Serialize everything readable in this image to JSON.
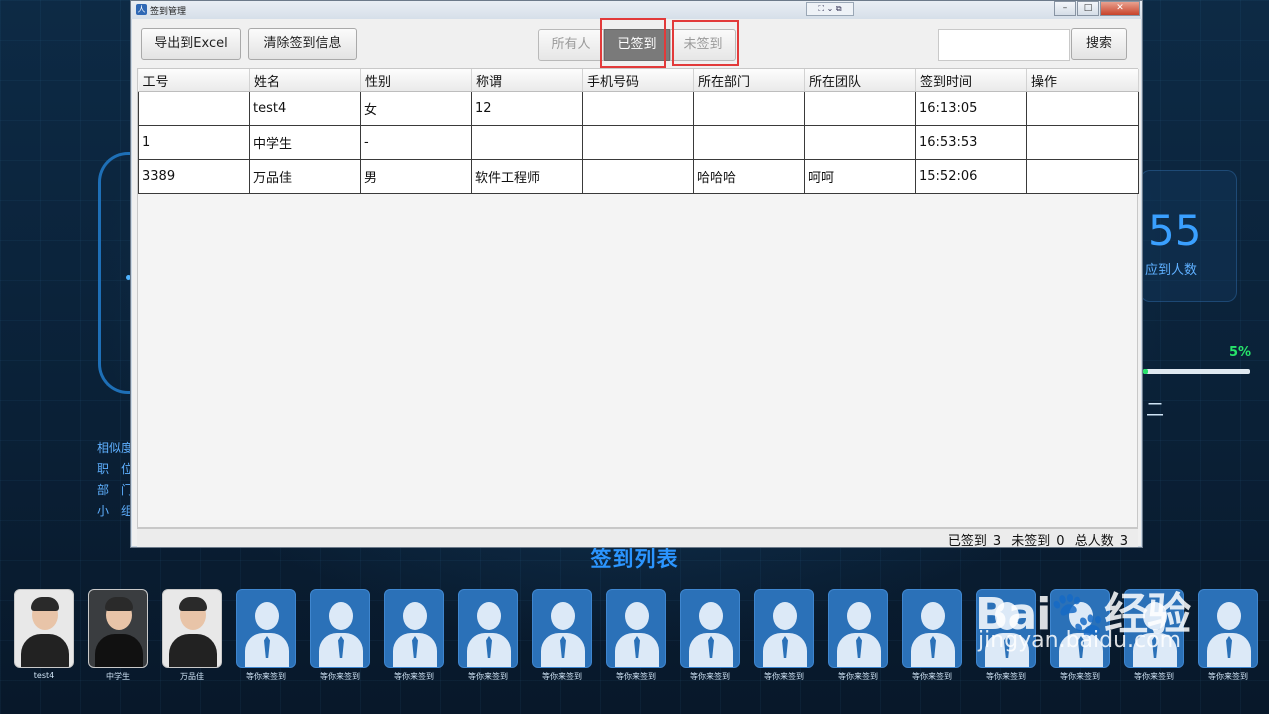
{
  "window": {
    "title": "签到管理",
    "mini_toolbar": "⛶ ⌄ ⧉"
  },
  "toolbar": {
    "export_label": "导出到Excel",
    "clear_label": "清除签到信息",
    "filters": {
      "all": "所有人",
      "signed": "已签到",
      "unsigned": "未签到"
    },
    "active_filter": "已签到",
    "search_value": "",
    "search_label": "搜索"
  },
  "table": {
    "columns": [
      "工号",
      "姓名",
      "性别",
      "称谓",
      "手机号码",
      "所在部门",
      "所在团队",
      "签到时间",
      "操作"
    ],
    "rows": [
      [
        "",
        "test4",
        "女",
        "12",
        "",
        "",
        "",
        "16:13:05",
        ""
      ],
      [
        "1",
        "中学生",
        "-",
        "",
        "",
        "",
        "",
        "16:53:53",
        ""
      ],
      [
        "3389",
        "万品佳",
        "男",
        "软件工程师",
        "",
        "哈哈哈",
        "呵呵",
        "15:52:06",
        ""
      ]
    ]
  },
  "status": {
    "signed_label": "已签到",
    "signed_count": "3",
    "unsigned_label": "未签到",
    "unsigned_count": "0",
    "total_label": "总人数",
    "total_count": "3"
  },
  "background": {
    "left_info": [
      "相似度",
      "职　位",
      "部　门",
      "小　组"
    ],
    "stat_number": "55",
    "stat_label": "应到人数",
    "progress_text": "5%",
    "progress_value": 0.05,
    "right_mark": "二",
    "list_title": "签到列表",
    "avatars": [
      {
        "name": "test4",
        "type": "photo"
      },
      {
        "name": "中学生",
        "type": "photo-dark"
      },
      {
        "name": "万品佳",
        "type": "photo"
      },
      {
        "name": "等你来签到",
        "type": "placeholder"
      },
      {
        "name": "等你来签到",
        "type": "placeholder"
      },
      {
        "name": "等你来签到",
        "type": "placeholder"
      },
      {
        "name": "等你来签到",
        "type": "placeholder"
      },
      {
        "name": "等你来签到",
        "type": "placeholder"
      },
      {
        "name": "等你来签到",
        "type": "placeholder"
      },
      {
        "name": "等你来签到",
        "type": "placeholder"
      },
      {
        "name": "等你来签到",
        "type": "placeholder"
      },
      {
        "name": "等你来签到",
        "type": "placeholder"
      },
      {
        "name": "等你来签到",
        "type": "placeholder"
      },
      {
        "name": "等你来签到",
        "type": "placeholder"
      },
      {
        "name": "等你来签到",
        "type": "placeholder"
      },
      {
        "name": "等你来签到",
        "type": "placeholder"
      },
      {
        "name": "等你来签到",
        "type": "placeholder"
      }
    ]
  },
  "watermark": {
    "logo": "Bai🐾经验",
    "url": "jingyan.baidu.com"
  },
  "colors": {
    "accent_blue": "#2b95ff",
    "progress_green": "#27e36a",
    "highlight_red": "#e23a3a",
    "active_filter_bg": "#7a7a7a"
  }
}
